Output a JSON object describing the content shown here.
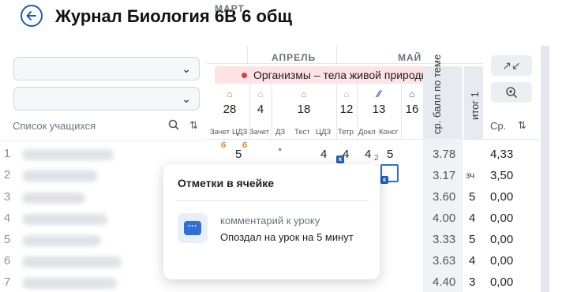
{
  "header": {
    "title": "Журнал Биология 6В 6 общ"
  },
  "sidebar": {
    "students_label": "Список учащихся"
  },
  "months": {
    "mar": "МАРТ",
    "apr": "АПРЕЛЬ",
    "may": "МАЙ"
  },
  "topic": "Организмы – тела живой природы",
  "days": [
    "28",
    "4",
    "18",
    "12",
    "13",
    "16"
  ],
  "day_types": [
    "Зачет",
    "ЦДЗ",
    "Зачет",
    "ДЗ",
    "Тест",
    "ЦДЗ",
    "Тетр",
    "Докл",
    "Консг"
  ],
  "marks": {
    "r1": [
      "5",
      "4",
      "4",
      "4",
      "5"
    ],
    "r1_sub": "2",
    "orange": [
      "б",
      "б"
    ],
    "k": "к"
  },
  "columns": {
    "avg_head": "ср. балл по теме",
    "itog_head": "итог 1",
    "cp_head": "Ср."
  },
  "rows": [
    {
      "num": "1",
      "avg": "3.78",
      "itog": "",
      "final": "",
      "cp": "4,33"
    },
    {
      "num": "2",
      "avg": "3.17",
      "itog": "зч",
      "final": "",
      "cp": "3,50"
    },
    {
      "num": "3",
      "avg": "3.60",
      "itog": "",
      "final": "5",
      "cp": "0,00"
    },
    {
      "num": "4",
      "avg": "4.00",
      "itog": "",
      "final": "4",
      "cp": "0,00"
    },
    {
      "num": "5",
      "avg": "3.33",
      "itog": "",
      "final": "5",
      "cp": "0,00"
    },
    {
      "num": "6",
      "avg": "3.63",
      "itog": "",
      "final": "4",
      "cp": "0,00"
    },
    {
      "num": "7",
      "avg": "4.40",
      "itog": "",
      "final": "3",
      "cp": "0,00"
    }
  ],
  "tooltip": {
    "title": "Отметки в ячейке",
    "kind": "комментарий к уроку",
    "text": "Опоздал на урок на 5 минут"
  }
}
